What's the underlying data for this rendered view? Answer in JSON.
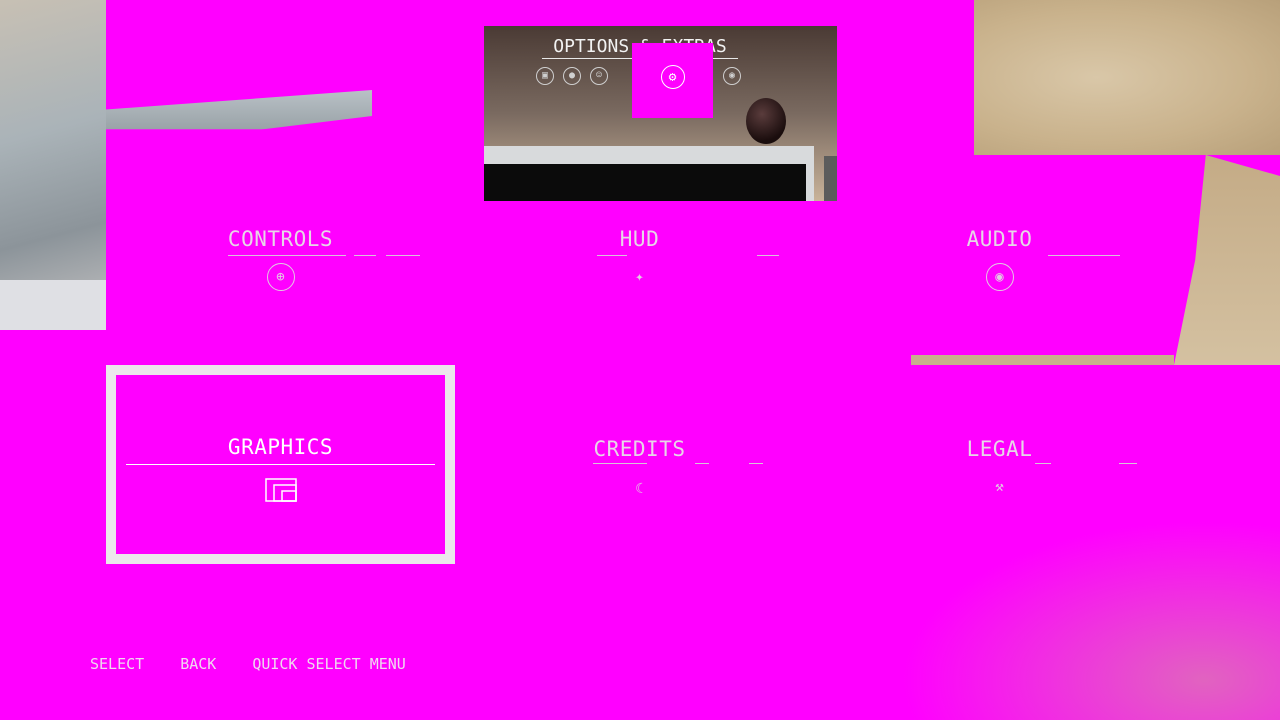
{
  "header": {
    "title": "OPTIONS & EXTRAS",
    "tab_icons": [
      "car-icon",
      "drop-icon",
      "face-icon",
      "gear-icon",
      "record-icon"
    ],
    "active_tab_icon": "gear-icon"
  },
  "tiles": [
    {
      "label": "CONTROLS",
      "icon": "steering-wheel-icon",
      "selected": false
    },
    {
      "label": "HUD",
      "icon": "crosshair-icon",
      "selected": false
    },
    {
      "label": "AUDIO",
      "icon": "speaker-icon",
      "selected": false
    },
    {
      "label": "GRAPHICS",
      "icon": "window-icon",
      "selected": true
    },
    {
      "label": "CREDITS",
      "icon": "moon-icon",
      "selected": false
    },
    {
      "label": "LEGAL",
      "icon": "gavel-icon",
      "selected": false
    }
  ],
  "footer": {
    "select": "SELECT",
    "back": "BACK",
    "quick_select": "QUICK SELECT MENU"
  },
  "colors": {
    "background": "#ff00ff",
    "selected_border": "#ece7ec",
    "label": "#e7d6e7"
  }
}
